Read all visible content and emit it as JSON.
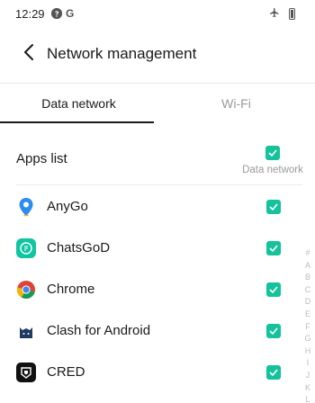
{
  "status_bar": {
    "time": "12:29",
    "left_icons": [
      "notification-dot-icon",
      "google-g-icon"
    ],
    "g_glyph": "G",
    "right_icons": [
      "airplane-mode-icon",
      "battery-icon"
    ]
  },
  "header": {
    "back_icon": "chevron-left-icon",
    "title": "Network management"
  },
  "tabs": [
    {
      "label": "Data network",
      "active": true
    },
    {
      "label": "Wi-Fi",
      "active": false
    }
  ],
  "apps_header": {
    "label": "Apps list",
    "column_caption": "Data network",
    "all_checked": true
  },
  "apps": [
    {
      "name": "AnyGo",
      "icon": "anygo-location-pin-icon",
      "checked": true
    },
    {
      "name": "ChatsGoD",
      "icon": "chatsgod-icon",
      "checked": true
    },
    {
      "name": "Chrome",
      "icon": "chrome-icon",
      "checked": true
    },
    {
      "name": "Clash for Android",
      "icon": "clash-cat-icon",
      "checked": true
    },
    {
      "name": "CRED",
      "icon": "cred-icon",
      "checked": true
    }
  ],
  "alpha_index": [
    "#",
    "A",
    "B",
    "C",
    "D",
    "E",
    "F",
    "G",
    "H",
    "I",
    "J",
    "K",
    "L"
  ],
  "colors": {
    "accent": "#14c29b",
    "text_primary": "#1a1a1a",
    "text_secondary": "#9a9a9a"
  }
}
